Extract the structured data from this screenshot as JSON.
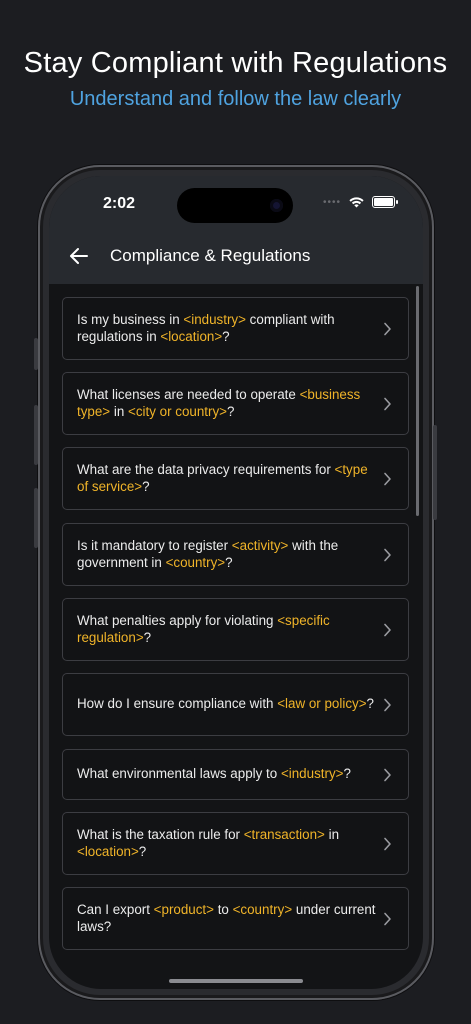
{
  "promo": {
    "headline": "Stay Compliant with Regulations",
    "subheadline": "Understand and follow the law clearly"
  },
  "status_bar": {
    "time": "2:02"
  },
  "nav": {
    "title": "Compliance & Regulations",
    "back_icon": "arrow-left-icon"
  },
  "colors": {
    "placeholder": "#f0b429",
    "accent": "#4fa3e0",
    "background": "#131416"
  },
  "questions": [
    {
      "segments": [
        {
          "text": "Is my business in ",
          "ph": false
        },
        {
          "text": "<industry>",
          "ph": true
        },
        {
          "text": " compliant with regulations in ",
          "ph": false
        },
        {
          "text": "<location>",
          "ph": true
        },
        {
          "text": "?",
          "ph": false
        }
      ]
    },
    {
      "segments": [
        {
          "text": "What licenses are needed to operate ",
          "ph": false
        },
        {
          "text": "<business type>",
          "ph": true
        },
        {
          "text": " in ",
          "ph": false
        },
        {
          "text": "<city or country>",
          "ph": true
        },
        {
          "text": "?",
          "ph": false
        }
      ]
    },
    {
      "segments": [
        {
          "text": "What are the data privacy requirements for ",
          "ph": false
        },
        {
          "text": "<type of service>",
          "ph": true
        },
        {
          "text": "?",
          "ph": false
        }
      ]
    },
    {
      "segments": [
        {
          "text": "Is it mandatory to register ",
          "ph": false
        },
        {
          "text": "<activity>",
          "ph": true
        },
        {
          "text": " with the government in ",
          "ph": false
        },
        {
          "text": "<country>",
          "ph": true
        },
        {
          "text": "?",
          "ph": false
        }
      ]
    },
    {
      "segments": [
        {
          "text": "What penalties apply for violating ",
          "ph": false
        },
        {
          "text": "<specific regulation>",
          "ph": true
        },
        {
          "text": "?",
          "ph": false
        }
      ]
    },
    {
      "segments": [
        {
          "text": "How do I ensure compliance with ",
          "ph": false
        },
        {
          "text": "<law or policy>",
          "ph": true
        },
        {
          "text": "?",
          "ph": false
        }
      ]
    },
    {
      "segments": [
        {
          "text": "What environmental laws apply to ",
          "ph": false
        },
        {
          "text": "<industry>",
          "ph": true
        },
        {
          "text": "?",
          "ph": false
        }
      ]
    },
    {
      "segments": [
        {
          "text": "What is the taxation rule for ",
          "ph": false
        },
        {
          "text": "<transaction>",
          "ph": true
        },
        {
          "text": " in ",
          "ph": false
        },
        {
          "text": "<location>",
          "ph": true
        },
        {
          "text": "?",
          "ph": false
        }
      ]
    },
    {
      "segments": [
        {
          "text": "Can I export ",
          "ph": false
        },
        {
          "text": "<product>",
          "ph": true
        },
        {
          "text": " to ",
          "ph": false
        },
        {
          "text": "<country>",
          "ph": true
        },
        {
          "text": " under current laws?",
          "ph": false
        }
      ]
    }
  ]
}
